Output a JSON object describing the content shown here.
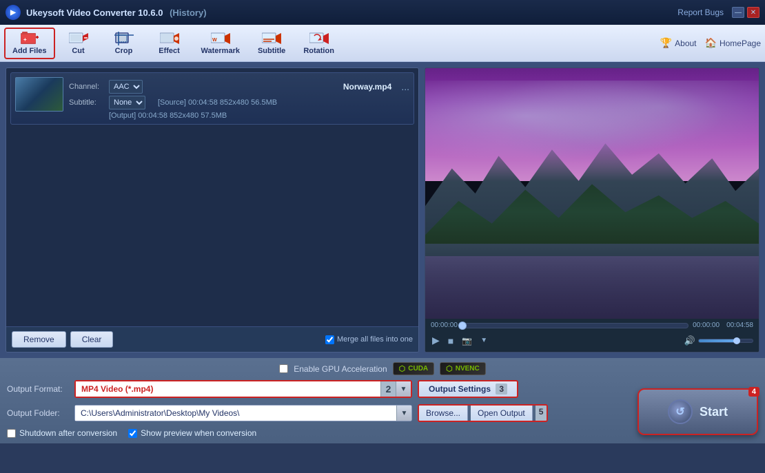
{
  "app": {
    "title": "Ukeysoft Video Converter 10.6.0",
    "history": "(History)",
    "report_bugs": "Report Bugs"
  },
  "titlebar": {
    "minimize": "—",
    "close": "✕"
  },
  "toolbar": {
    "add_files": "Add Files",
    "cut": "Cut",
    "crop": "Crop",
    "effect": "Effect",
    "watermark": "Watermark",
    "subtitle": "Subtitle",
    "rotation": "Rotation",
    "about": "About",
    "homepage": "HomePage"
  },
  "file": {
    "name": "Norway.mp4",
    "more": "...",
    "channel_label": "Channel:",
    "channel_value": "AAC",
    "subtitle_label": "Subtitle:",
    "subtitle_value": "None",
    "source": "[Source]  00:04:58  852x480  56.5MB",
    "output": "[Output]  00:04:58  852x480  57.5MB"
  },
  "panel_buttons": {
    "remove": "Remove",
    "clear": "Clear",
    "merge_label": "Merge all files into one"
  },
  "preview": {
    "time_start": "00:00:00",
    "time_mid": "00:00:00",
    "time_end": "00:04:58"
  },
  "gpu": {
    "label": "Enable GPU Acceleration",
    "cuda": "CUDA",
    "nvenc": "NVENC"
  },
  "output_format": {
    "label": "Output Format:",
    "value": "MP4 Video (*.mp4)",
    "num": "2",
    "settings_btn": "Output Settings",
    "settings_num": "3"
  },
  "output_folder": {
    "label": "Output Folder:",
    "path": "C:\\Users\\Administrator\\Desktop\\My Videos\\",
    "browse": "Browse...",
    "open": "Open Output",
    "num": "5"
  },
  "options": {
    "shutdown_label": "Shutdown after conversion",
    "preview_label": "Show preview when conversion"
  },
  "start": {
    "label": "Start",
    "num": "4"
  }
}
